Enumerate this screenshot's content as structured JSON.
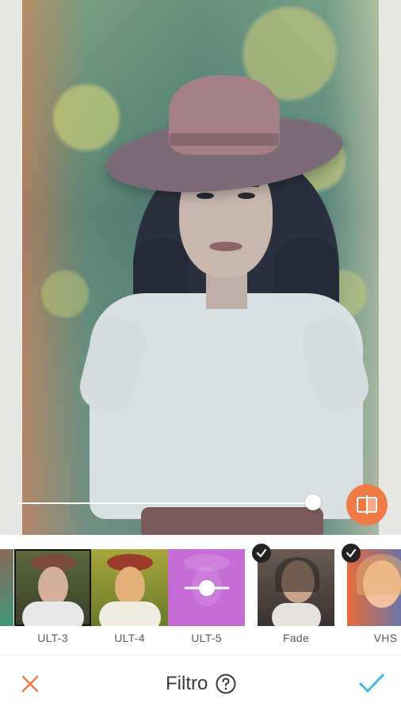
{
  "filters": [
    {
      "label": "ULT-3",
      "selected": true,
      "downloaded": true
    },
    {
      "label": "ULT-4",
      "selected": false,
      "downloaded": true
    },
    {
      "label": "ULT-5",
      "selected": false,
      "downloaded": true
    },
    {
      "label": "Fade",
      "selected": false,
      "downloaded": true
    },
    {
      "label": "VHS",
      "selected": false,
      "downloaded": true
    }
  ],
  "slider": {
    "intensity": 1.0
  },
  "toolbar": {
    "title": "Filtro",
    "help_icon": "question-circle-icon",
    "cancel_icon": "close-icon",
    "apply_icon": "checkmark-icon"
  },
  "colors": {
    "accent_orange": "#ef7a45",
    "accent_blue": "#3eb8e6",
    "active_filter_purple": "#c56bd6"
  }
}
